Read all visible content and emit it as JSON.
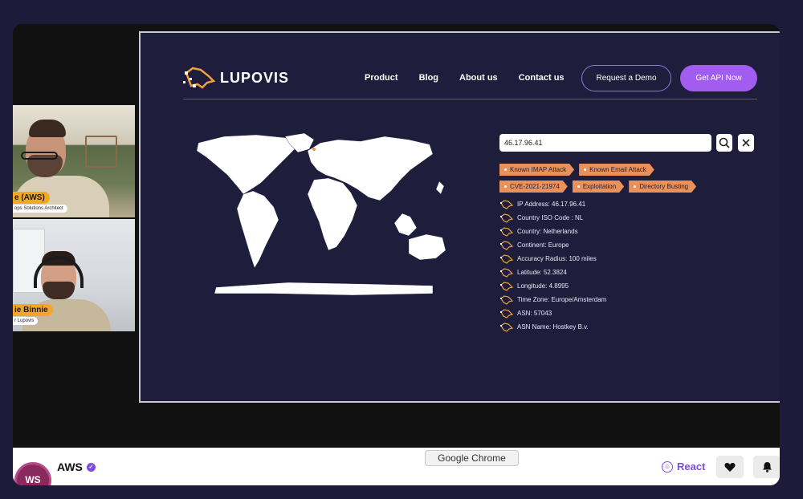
{
  "participants": [
    {
      "name": "e (AWS)",
      "role": "ops Solutions Architect"
    },
    {
      "name": "ie Binnie",
      "role": "r Lupovis"
    }
  ],
  "site": {
    "brand": "LUPOVIS",
    "nav": [
      "Product",
      "Blog",
      "About us",
      "Contact us"
    ],
    "demo_button": "Request a Demo",
    "api_button": "Get API Now"
  },
  "lookup": {
    "ip_value": "46.17.96.41",
    "tags": [
      [
        "Known IMAP Attack",
        "Known Email Attack"
      ],
      [
        "CVE-2021-21974",
        "Exploitation",
        "Directory Busting"
      ]
    ],
    "details": [
      "IP Address: 46.17.96.41",
      "Country ISO Code : NL",
      "Country: Netherlands",
      "Continent: Europe",
      "Accuracy Radius: 100 miles",
      "Latitude: 52.3824",
      "Longitude: 4.8995",
      "Time Zone: Europe/Amsterdam",
      "ASN: 57043",
      "ASN Name: Hostkey B.v."
    ]
  },
  "channel": {
    "name": "AWS",
    "avatar_text": "WS",
    "react_label": "React"
  },
  "tooltip": "Google Chrome",
  "icons": {
    "search": "search-icon",
    "close": "close-icon",
    "heart": "heart-icon",
    "bell": "bell-icon",
    "verified": "verified-badge-icon",
    "react": "smiley-icon",
    "detail": "lupovis-mark-icon"
  },
  "colors": {
    "page_bg": "#1e1b3a",
    "screen_bg": "#1e1d3c",
    "accent_purple": "#a25cf0",
    "tag_orange": "#e8915a",
    "name_tag": "#f5a623"
  }
}
